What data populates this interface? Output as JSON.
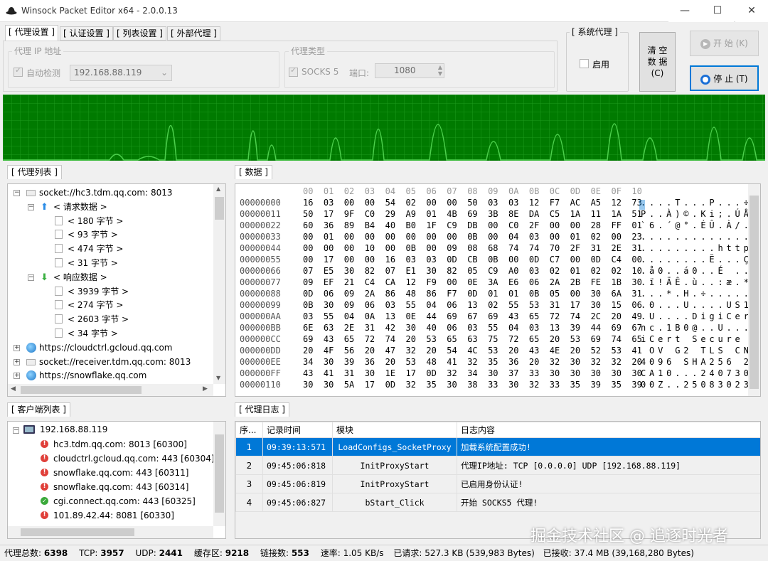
{
  "window": {
    "title": "Winsock Packet Editor x64 - 2.0.0.13",
    "min": "—",
    "max": "☐",
    "close": "✕"
  },
  "tabs": [
    "[ 代理设置 ]",
    "[ 认证设置 ]",
    "[ 列表设置 ]",
    "[ 外部代理 ]"
  ],
  "proxy_ip": {
    "group_label": "代理 IP 地址",
    "auto_detect_label": "自动检测",
    "auto_detect_checked": true,
    "ip_value": "192.168.88.119"
  },
  "proxy_type": {
    "group_label": "代理类型",
    "socks5_label": "SOCKS 5",
    "socks5_checked": true,
    "port_label": "端口:",
    "port_value": "1080"
  },
  "system_proxy": {
    "group_label": "[ 系统代理 ]",
    "enable_label": "启用",
    "enabled": false
  },
  "buttons": {
    "clear_line1": "清 空",
    "clear_line2": "数 据",
    "clear_line3": "(C)",
    "start": "开 始 (K)",
    "stop": "停 止 (T)"
  },
  "proxy_list": {
    "title": "[ 代理列表 ]",
    "items": [
      {
        "label": "socket://hc3.tdm.qq.com: 8013"
      },
      {
        "label": "< 请求数据 >"
      },
      {
        "label": "< 180 字节 >"
      },
      {
        "label": "< 93 字节 >"
      },
      {
        "label": "< 474 字节 >"
      },
      {
        "label": "< 31 字节 >"
      },
      {
        "label": "< 响应数据 >"
      },
      {
        "label": "< 3939 字节 >"
      },
      {
        "label": "< 274 字节 >"
      },
      {
        "label": "< 2603 字节 >"
      },
      {
        "label": "< 34 字节 >"
      },
      {
        "label": "https://cloudctrl.gcloud.qq.com"
      },
      {
        "label": "socket://receiver.tdm.qq.com: 8013"
      },
      {
        "label": "https://snowflake.qq.com"
      }
    ]
  },
  "data_panel": {
    "title": "[ 数据 ]",
    "header": "00  01  02  03  04  05  06  07  08  09  0A  0B  0C  0D  0E  0F  10",
    "rows": [
      {
        "offset": "00000000",
        "hex": "16  03  00  00  54  02  00  00  50  03  03  12  F7  AC  A5  12  73",
        "ascii": ". . . . T . . . P . . . ÷ ¬ ¥ . s"
      },
      {
        "offset": "00000011",
        "hex": "50  17  9F  C0  29  A9  01  4B  69  3B  8E  DA  C5  1A  11  1A  51",
        "ascii": "P . . À ) © . K i ; . Ú Å . . . Q"
      },
      {
        "offset": "00000022",
        "hex": "60  36  89  B4  40  B0  1F  C9  DB  00  C0  2F  00  00  28  FF  01",
        "ascii": "` 6 . ´ @ ° . É Û . À / . . ( ÿ ."
      },
      {
        "offset": "00000033",
        "hex": "00  01  00  00  00  00  00  00  0B  00  04  03  00  01  02  00  23",
        "ascii": ". . . . . . . . . . . . . . . . #"
      },
      {
        "offset": "00000044",
        "hex": "00  00  00  10  00  0B  00  09  08  68  74  74  70  2F  31  2E  31",
        "ascii": ". . . . . . . . . h t t p / 1 . 1"
      },
      {
        "offset": "00000055",
        "hex": "00  17  00  00  16  03  03  0D  CB  0B  00  0D  C7  00  0D  C4  00",
        "ascii": ". . . . . . . . Ë . . . Ç . . Ä ."
      },
      {
        "offset": "00000066",
        "hex": "07  E5  30  82  07  E1  30  82  05  C9  A0  03  02  01  02  02  10",
        "ascii": ". å 0 . . á 0 . . É   . . . . . ."
      },
      {
        "offset": "00000077",
        "hex": "09  EF  21  C4  CA  12  F9  00  0E  3A  E6  06  2A  2B  FE  1B  30",
        "ascii": ". ï ! Ä Ê . ù . . : æ . * + þ . 0"
      },
      {
        "offset": "00000088",
        "hex": "0D  06  09  2A  86  48  86  F7  0D  01  01  0B  05  00  30  6A  31",
        "ascii": ". . . * . H . ÷ . . . . . . 0 j 1"
      },
      {
        "offset": "00000099",
        "hex": "0B  30  09  06  03  55  04  06  13  02  55  53  31  17  30  15  06",
        "ascii": ". 0 . . . U . . . . U S 1 . 0 . ."
      },
      {
        "offset": "000000AA",
        "hex": "03  55  04  0A  13  0E  44  69  67  69  43  65  72  74  2C  20  49",
        "ascii": ". U . . . . D i g i C e r t ,   I"
      },
      {
        "offset": "000000BB",
        "hex": "6E  63  2E  31  42  30  40  06  03  55  04  03  13  39  44  69  67",
        "ascii": "n c . 1 B 0 @ . . U . . . 9 D i g"
      },
      {
        "offset": "000000CC",
        "hex": "69  43  65  72  74  20  53  65  63  75  72  65  20  53  69  74  65",
        "ascii": "i C e r t   S e c u r e   S i t e"
      },
      {
        "offset": "000000DD",
        "hex": "20  4F  56  20  47  32  20  54  4C  53  20  43  4E  20  52  53  41",
        "ascii": "  O V   G 2   T L S   C N   R S A"
      },
      {
        "offset": "000000EE",
        "hex": "34  30  39  36  20  53  48  41  32  35  36  20  32  30  32  32  20",
        "ascii": "4 0 9 6   S H A 2 5 6   2 0 2 2  "
      },
      {
        "offset": "000000FF",
        "hex": "43  41  31  30  1E  17  0D  32  34  30  37  33  30  30  30  30  30",
        "ascii": "C A 1 0 . . . 2 4 0 7 3 0 0 0 0 0"
      },
      {
        "offset": "00000110",
        "hex": "30  30  5A  17  0D  32  35  30  38  33  30  32  33  35  39  35  39",
        "ascii": "0 0 Z . . 2 5 0 8 3 0 2 3 5 9 5 9"
      }
    ]
  },
  "client_list": {
    "title": "[ 客户端列表 ]",
    "root": "192.168.88.119",
    "items": [
      {
        "label": "hc3.tdm.qq.com: 8013 [60300]",
        "status": "error"
      },
      {
        "label": "cloudctrl.gcloud.qq.com: 443 [60304]",
        "status": "error"
      },
      {
        "label": "snowflake.qq.com: 443 [60311]",
        "status": "error"
      },
      {
        "label": "snowflake.qq.com: 443 [60314]",
        "status": "error"
      },
      {
        "label": "cgi.connect.qq.com: 443 [60325]",
        "status": "ok"
      },
      {
        "label": "101.89.42.44: 8081 [60330]",
        "status": "error"
      }
    ]
  },
  "log": {
    "title": "[ 代理日志 ]",
    "columns": [
      "序...",
      "记录时间",
      "模块",
      "日志内容"
    ],
    "rows": [
      {
        "no": "1",
        "time": "09:39:13:571",
        "module": "LoadConfigs_SocketProxy",
        "msg": "加载系统配置成功!"
      },
      {
        "no": "2",
        "time": "09:45:06:818",
        "module": "InitProxyStart",
        "msg": "代理IP地址: TCP [0.0.0.0] UDP [192.168.88.119]"
      },
      {
        "no": "3",
        "time": "09:45:06:819",
        "module": "InitProxyStart",
        "msg": "已启用身份认证!"
      },
      {
        "no": "4",
        "time": "09:45:06:827",
        "module": "bStart_Click",
        "msg": "开始 SOCKS5 代理!"
      }
    ]
  },
  "status": {
    "total_label": "代理总数:",
    "total": "6398",
    "tcp_label": "TCP:",
    "tcp": "3957",
    "udp_label": "UDP:",
    "udp": "2441",
    "buffer_label": "缓存区:",
    "buffer": "9218",
    "conn_label": "链接数:",
    "conn": "553",
    "rate": "速率: 1.05 KB/s",
    "requested": "已请求: 527.3 KB (539,983 Bytes)",
    "received": "已接收: 37.4 MB (39,168,280 Bytes)"
  },
  "watermark": "掘金技术社区 @ 追逐时光者",
  "colors": {
    "wave_bg": "#007a00",
    "grid": "#22a822",
    "selection": "#0078d7"
  }
}
